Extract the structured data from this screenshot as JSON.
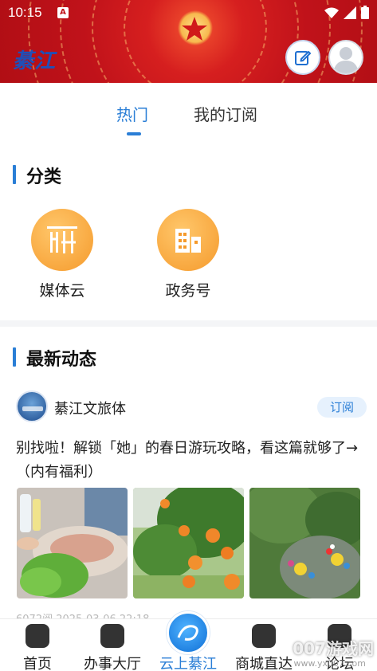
{
  "status_bar": {
    "time": "10:15",
    "notification_icon": "A"
  },
  "header": {
    "logo_text": "綦江",
    "edit_icon": "edit-icon",
    "avatar_icon": "user-avatar-icon"
  },
  "tabs": [
    {
      "label": "热门",
      "active": true
    },
    {
      "label": "我的订阅",
      "active": false
    }
  ],
  "category_section": {
    "title": "分类",
    "items": [
      {
        "label": "媒体云",
        "icon": "media-cloud-icon"
      },
      {
        "label": "政务号",
        "icon": "government-building-icon"
      }
    ]
  },
  "news_section": {
    "title": "最新动态",
    "source": {
      "name": "綦江文旅体",
      "subscribe_label": "订阅"
    },
    "article": {
      "title": "别找啦！解锁「她」的春日游玩攻略，看这篇就够了→（内有福利）",
      "meta": "6072阅  2025-03-06 22:18",
      "images": [
        "bbq-feast-image",
        "orange-tree-image",
        "garden-tables-image"
      ]
    }
  },
  "bottom_nav": [
    {
      "label": "首页",
      "icon": "home-icon",
      "active": false
    },
    {
      "label": "办事大厅",
      "icon": "service-hall-icon",
      "active": false
    },
    {
      "label": "云上綦江",
      "icon": "cloud-qijiang-icon",
      "active": true
    },
    {
      "label": "商城直达",
      "icon": "shopping-bag-icon",
      "active": false
    },
    {
      "label": "论坛",
      "icon": "forum-icon",
      "active": false
    }
  ],
  "watermark": {
    "text": "007游戏网",
    "url_text": "www.yx007.com"
  },
  "colors": {
    "accent": "#2a7ed6",
    "header_red": "#c0121a",
    "category_orange": "#f59a2c"
  }
}
